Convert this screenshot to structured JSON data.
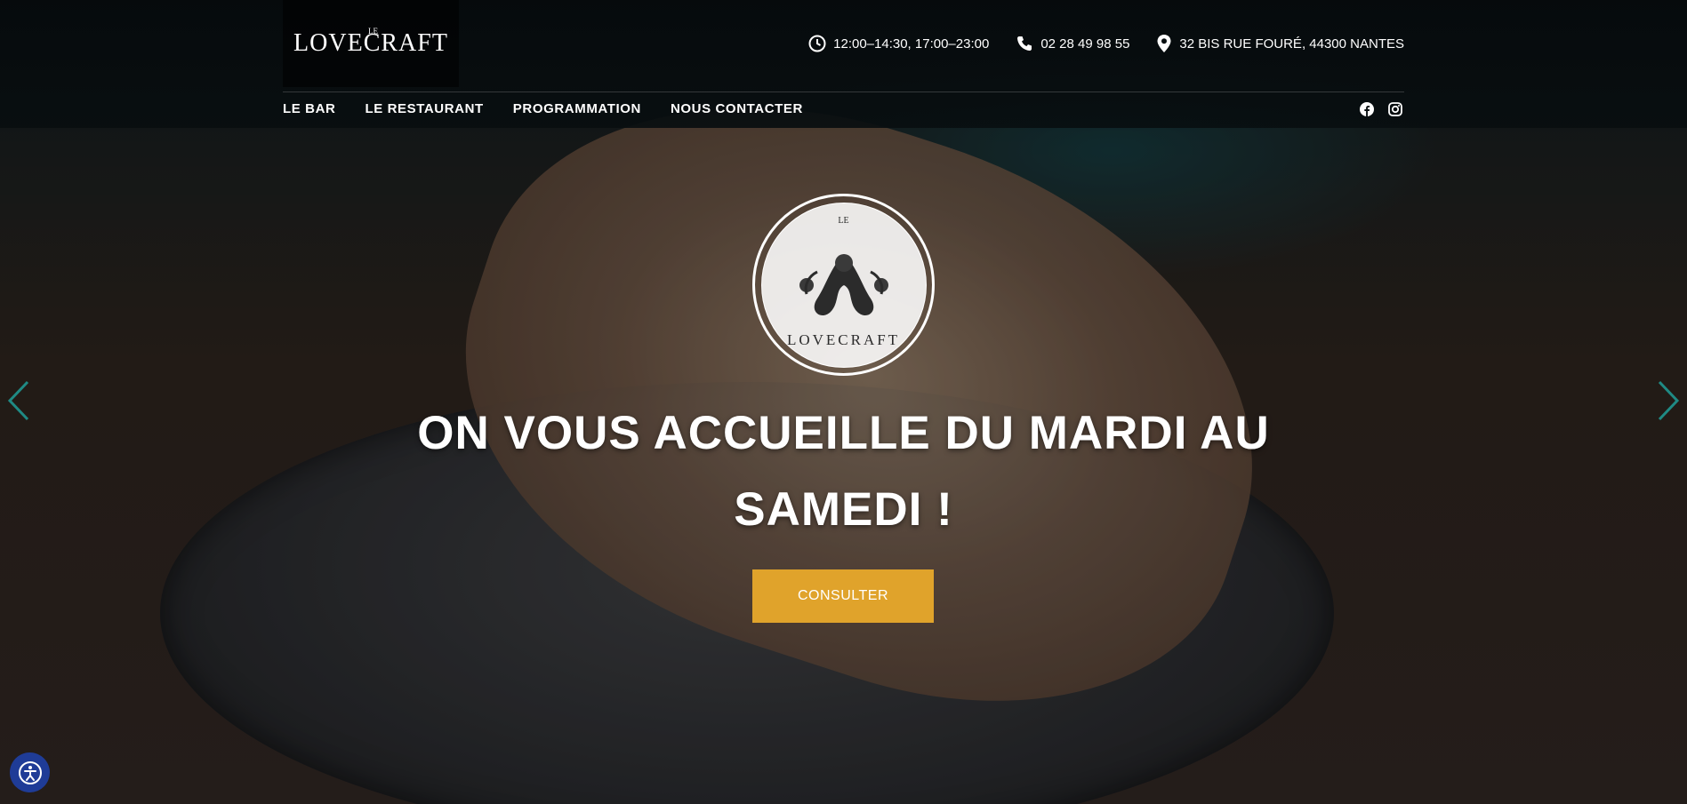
{
  "brand": {
    "logo_text": "LOVECRAFT",
    "logo_prefix": "LE",
    "accent_color": "#e0a32b",
    "a11y_color": "#1f3c97"
  },
  "contact": {
    "hours": "12:00–14:30, 17:00–23:00",
    "phone": "02 28 49 98 55",
    "address": "32 BIS RUE FOURÉ, 44300 NANTES"
  },
  "nav": {
    "items": [
      {
        "label": "LE BAR"
      },
      {
        "label": "LE RESTAURANT"
      },
      {
        "label": "PROGRAMMATION"
      },
      {
        "label": "NOUS CONTACTER"
      }
    ]
  },
  "social": {
    "icons": [
      "facebook-icon",
      "instagram-icon"
    ]
  },
  "hero": {
    "seal_text": "LOVECRAFT",
    "seal_prefix": "LE",
    "headline_line1": "ON VOUS ACCUEILLE DU MARDI AU",
    "headline_line2": "SAMEDI !",
    "cta_label": "CONSULTER"
  }
}
